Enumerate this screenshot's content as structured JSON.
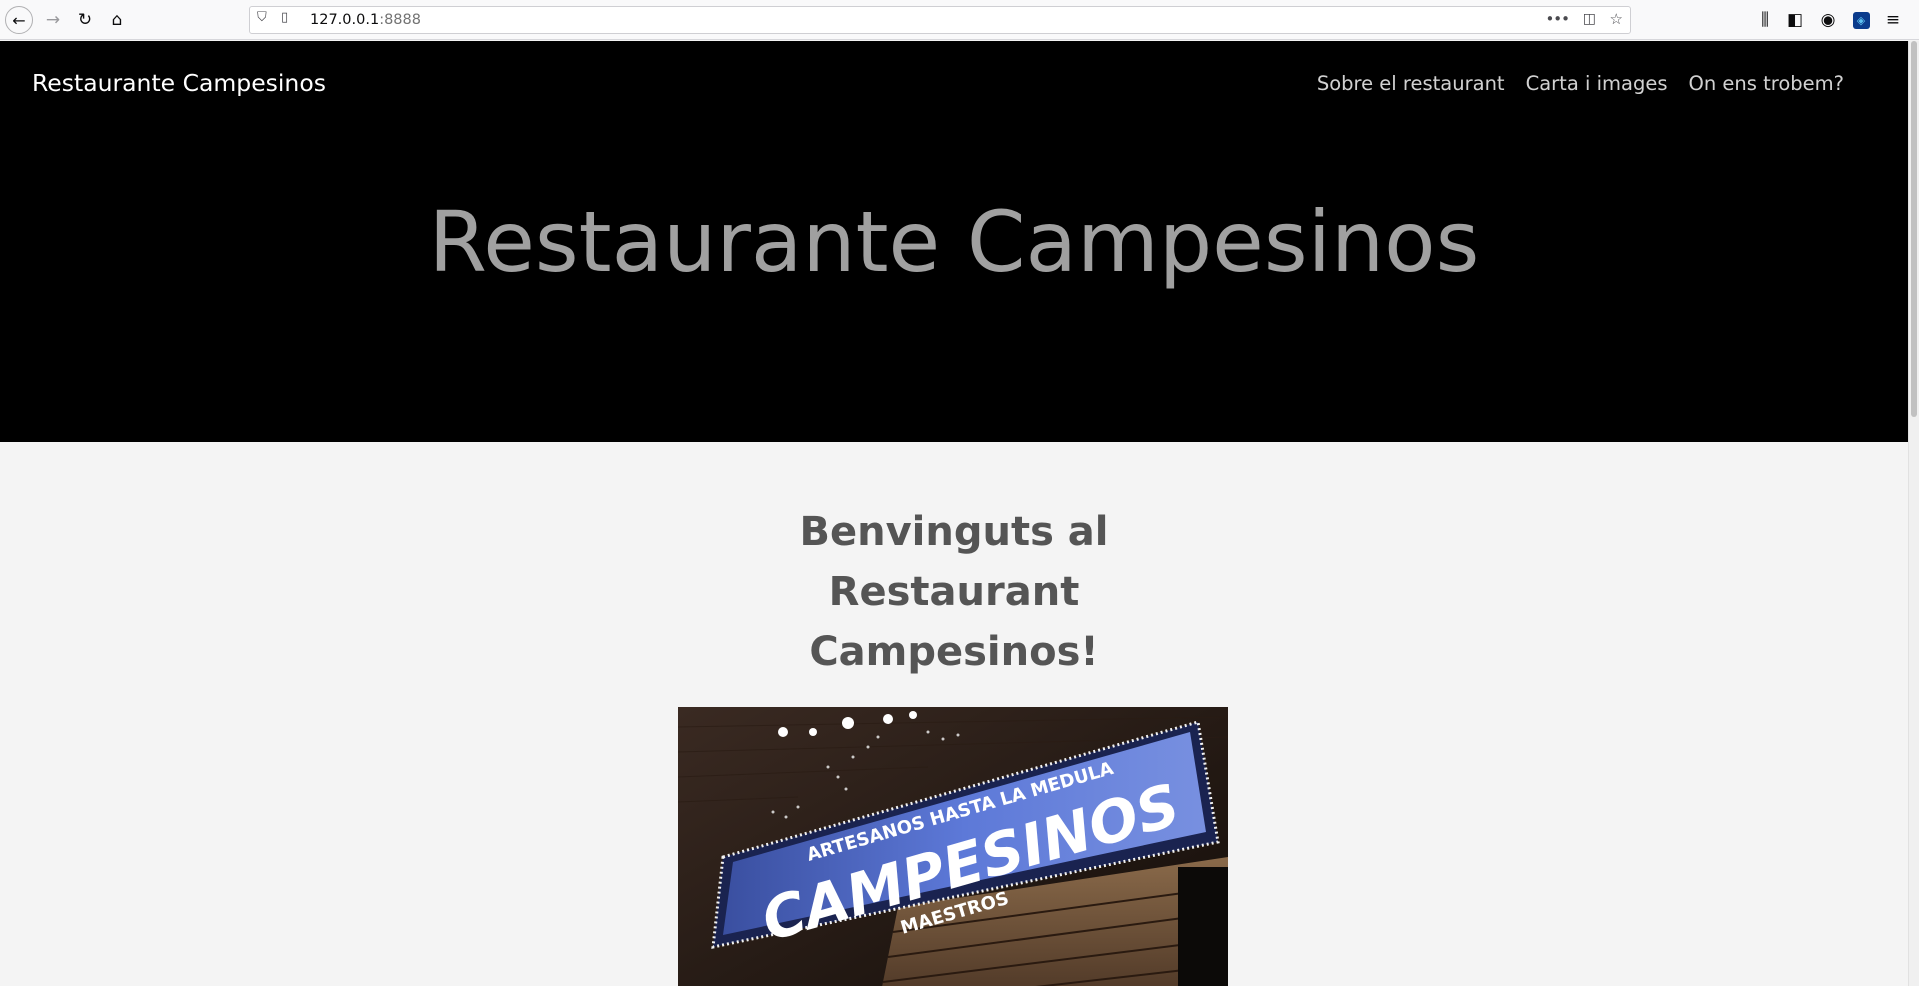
{
  "browser": {
    "url_host": "127.0.0.1",
    "url_port": ":8888"
  },
  "site": {
    "brand": "Restaurante Campesinos",
    "nav": [
      {
        "label": "Sobre el restaurant"
      },
      {
        "label": "Carta i images"
      },
      {
        "label": "On ens trobem?"
      }
    ],
    "hero_title": "Restaurante Campesinos"
  },
  "main": {
    "welcome_heading": "Benvinguts al Restaurant Campesinos!",
    "photo": {
      "sign_tagline": "ARTESANOS HASTA LA MEDULA",
      "sign_name": "CAMPESINOS",
      "sign_sub": "MAESTROS"
    }
  },
  "colors": {
    "hero_bg": "#000000",
    "page_bg": "#f4f4f4",
    "heading": "#555555",
    "hero_title": "#a0a0a0"
  }
}
